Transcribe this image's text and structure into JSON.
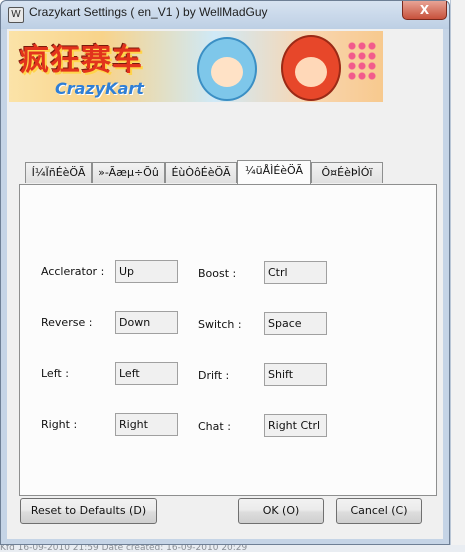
{
  "window": {
    "title": "Crazykart Settings ( en_V1 ) by WellMadGuy",
    "close_label": "X"
  },
  "banner": {
    "logo_cn": "疯狂赛车",
    "logo_en": "CrazyKart"
  },
  "tabs": [
    {
      "label": "Í¼ÏñÉèÖÃ",
      "active": false
    },
    {
      "label": "»-Ãæµ÷Õû",
      "active": false
    },
    {
      "label": "ÉùÒôÉèÖÃ",
      "active": false
    },
    {
      "label": "¼üÅÌÉèÖÃ",
      "active": true
    },
    {
      "label": "Ô¤ÉèÞÌÓï",
      "active": false
    }
  ],
  "controls": {
    "accelerator": {
      "label": "Acclerator :",
      "value": "Up"
    },
    "reverse": {
      "label": "Reverse :",
      "value": "Down"
    },
    "left": {
      "label": "Left :",
      "value": "Left"
    },
    "right": {
      "label": "Right :",
      "value": "Right"
    },
    "boost": {
      "label": "Boost :",
      "value": "Ctrl"
    },
    "switch": {
      "label": "Switch :",
      "value": "Space"
    },
    "drift": {
      "label": "Drift :",
      "value": "Shift"
    },
    "chat": {
      "label": "Chat :",
      "value": "Right Ctrl"
    }
  },
  "buttons": {
    "reset": "Reset to Defaults (D)",
    "ok": "OK (O)",
    "cancel": "Cancel (C)"
  },
  "background": {
    "bottom_text": "Kfd 16-09-2010 21:59     Date created: 16-09-2010 20:29"
  }
}
